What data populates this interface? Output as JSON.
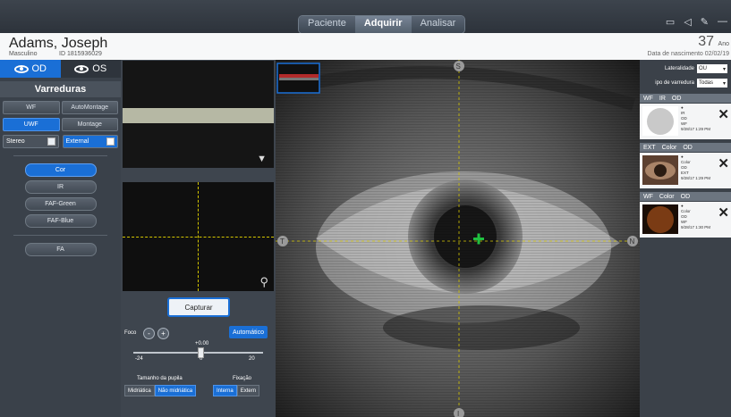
{
  "nav": {
    "tabs": [
      "Paciente",
      "Adquirir",
      "Analisar"
    ],
    "active": 1
  },
  "patient": {
    "name": "Adams, Joseph",
    "sex": "Masculino",
    "id": "ID 1815936029",
    "age": "37",
    "age_unit": "Ano",
    "dob": "Data de nascimento  02/02/19"
  },
  "eyes": {
    "od": "OD",
    "os": "OS"
  },
  "scans": {
    "title": "Varreduras",
    "row1": [
      "WF",
      "AutoMontage"
    ],
    "row2": [
      "UWF",
      "Montage"
    ],
    "stereo": "Stereo",
    "external": "External",
    "modes": [
      "Cor",
      "IR",
      "FAF-Green",
      "FAF-Blue"
    ],
    "fa": "FA"
  },
  "capture": {
    "button": "Capturar",
    "focus_label": "Foco",
    "minus": "-",
    "plus": "+",
    "auto": "Automático",
    "focus_value": "+0.00",
    "focus_min": "-24",
    "focus_mid": "0",
    "focus_max": "20",
    "pupil_label": "Tamanho da pupila",
    "pupil_options": [
      "Midriática",
      "Não midriática"
    ],
    "fixation_label": "Fixação",
    "fixation_options": [
      "Interna",
      "Extern"
    ]
  },
  "markers": {
    "top": "S",
    "left": "T",
    "right": "N",
    "bottom": "I"
  },
  "right": {
    "laterality_label": "Lateralidade",
    "laterality_value": "OU",
    "scan_type_label": "ipo de varredura",
    "scan_type_value": "Todas",
    "groups": [
      {
        "h": [
          "WF",
          "IR",
          "OD"
        ],
        "lines": [
          "IR",
          "OD",
          "WF",
          "9/28/17  1:29 PM"
        ],
        "tone": "#c9c9c9"
      },
      {
        "h": [
          "EXT",
          "Color",
          "OD"
        ],
        "lines": [
          "Color",
          "OD",
          "EXT",
          "9/28/17  1:29 PM"
        ],
        "tone": "#8a6246"
      },
      {
        "h": [
          "WF",
          "Color",
          "OD"
        ],
        "lines": [
          "Color",
          "OD",
          "WF",
          "9/28/17  1:30 PM"
        ],
        "tone": "#7a3b14"
      }
    ]
  },
  "colors": {
    "accent": "#1a6fd6",
    "crosshair": "#d4c600",
    "fixation": "#20c040"
  }
}
